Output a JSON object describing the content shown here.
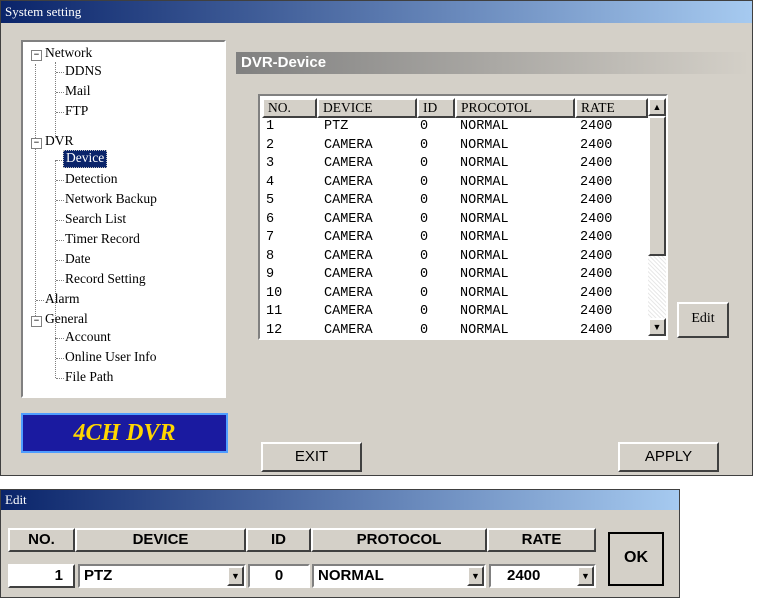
{
  "window": {
    "title": "System setting"
  },
  "tree": {
    "items": [
      {
        "label": "Network"
      },
      {
        "label": "DDNS"
      },
      {
        "label": "Mail"
      },
      {
        "label": "FTP"
      },
      {
        "label": "DVR"
      },
      {
        "label": "Device"
      },
      {
        "label": "Detection"
      },
      {
        "label": "Network Backup"
      },
      {
        "label": "Search List"
      },
      {
        "label": "Timer Record"
      },
      {
        "label": "Date"
      },
      {
        "label": "Record Setting"
      },
      {
        "label": "Alarm"
      },
      {
        "label": "General"
      },
      {
        "label": "Account"
      },
      {
        "label": "Online User Info"
      },
      {
        "label": "File Path"
      }
    ],
    "expanded_glyph": "−",
    "selected": "Device"
  },
  "logo": {
    "text": "4CH DVR"
  },
  "section": {
    "title": "DVR-Device"
  },
  "table": {
    "columns": [
      "NO.",
      "DEVICE",
      "ID",
      "PROCOTOL",
      "RATE"
    ],
    "rows": [
      [
        "1",
        "PTZ",
        "0",
        "NORMAL",
        "2400"
      ],
      [
        "2",
        "CAMERA",
        "0",
        "NORMAL",
        "2400"
      ],
      [
        "3",
        "CAMERA",
        "0",
        "NORMAL",
        "2400"
      ],
      [
        "4",
        "CAMERA",
        "0",
        "NORMAL",
        "2400"
      ],
      [
        "5",
        "CAMERA",
        "0",
        "NORMAL",
        "2400"
      ],
      [
        "6",
        "CAMERA",
        "0",
        "NORMAL",
        "2400"
      ],
      [
        "7",
        "CAMERA",
        "0",
        "NORMAL",
        "2400"
      ],
      [
        "8",
        "CAMERA",
        "0",
        "NORMAL",
        "2400"
      ],
      [
        "9",
        "CAMERA",
        "0",
        "NORMAL",
        "2400"
      ],
      [
        "10",
        "CAMERA",
        "0",
        "NORMAL",
        "2400"
      ],
      [
        "11",
        "CAMERA",
        "0",
        "NORMAL",
        "2400"
      ],
      [
        "12",
        "CAMERA",
        "0",
        "NORMAL",
        "2400"
      ]
    ],
    "scroll_up_glyph": "▲",
    "scroll_down_glyph": "▼"
  },
  "buttons": {
    "edit": "Edit",
    "exit": "EXIT",
    "apply": "APPLY"
  },
  "edit_dialog": {
    "title": "Edit",
    "columns": [
      "NO.",
      "DEVICE",
      "ID",
      "PROTOCOL",
      "RATE"
    ],
    "no": "1",
    "device": "PTZ",
    "id": "0",
    "protocol": "NORMAL",
    "rate": "2400",
    "ok": "OK",
    "dropdown_glyph": "▼"
  },
  "colors": {
    "title_start": "#0a246a",
    "title_end": "#a6caf0",
    "logo_bg": "#1a1aa0",
    "logo_text": "#ffd700",
    "face": "#d4d0c8"
  }
}
